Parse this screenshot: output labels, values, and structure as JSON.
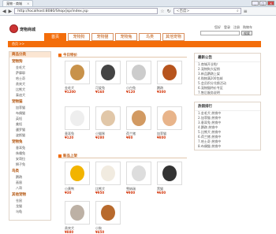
{
  "browser": {
    "tab_title": "宠物 - 商城",
    "tab_close": "×",
    "url": "http://localhost:8080/Shop/jsp/index.jsp",
    "search_placeholder": "<百度>",
    "search_mag": "⌕",
    "nav_back": "◀",
    "nav_forward": "▶",
    "nav_reload": "↻",
    "menu": "≡",
    "star": "☆",
    "win_min": "_",
    "win_max": "□",
    "win_close": "×"
  },
  "site": {
    "logo_text": "宠物商城",
    "top_links": [
      "您好",
      "登录",
      "注册",
      "购物车"
    ],
    "search_btn": "搜索",
    "nav": [
      "首页",
      "宠物狗",
      "宠物猫",
      "宠物兔",
      "鸟类",
      "其他宠物"
    ],
    "orange_bar": "首页 >>"
  },
  "sidebar": {
    "title": "商品分类",
    "groups": [
      {
        "name": "宠物狗",
        "items": [
          "金毛犬",
          "萨摩耶",
          "哈士奇",
          "贵宾犬",
          "比熊犬",
          "泰迪犬"
        ]
      },
      {
        "name": "宠物猫",
        "items": [
          "加菲猫",
          "布偶猫",
          "英短",
          "美短",
          "暹罗猫",
          "波斯猫"
        ]
      },
      {
        "name": "宠物兔",
        "items": [
          "垂耳兔",
          "侏儒兔",
          "安哥拉",
          "狮子兔"
        ]
      },
      {
        "name": "鸟类",
        "items": [
          "鹦鹉",
          "画眉",
          "八哥"
        ]
      },
      {
        "name": "其他宠物",
        "items": [
          "仓鼠",
          "龙猫",
          "乌龟"
        ]
      }
    ]
  },
  "hot": {
    "title": "今日特价",
    "products": [
      {
        "name": "金毛犬",
        "price": "¥1200",
        "color": "#c8924a"
      },
      {
        "name": "可爱兔",
        "price": "¥160",
        "color": "#444"
      },
      {
        "name": "小白兔",
        "price": "¥120",
        "color": "#ccc"
      },
      {
        "name": "鹦鹉",
        "price": "¥300",
        "color": "#b7541d"
      },
      {
        "name": "垂耳兔",
        "price": "¥120",
        "color": "#eee"
      },
      {
        "name": "小猫咪",
        "price": "¥280",
        "color": "#e1c7a8"
      },
      {
        "name": "荷兰猪",
        "price": "¥80",
        "color": "#d29a62"
      },
      {
        "name": "加菲猫",
        "price": "¥800",
        "color": "#e8b48a"
      }
    ]
  },
  "new_items": {
    "title": "新品上架",
    "products": [
      {
        "name": "小黄鸭",
        "price": "¥30",
        "color": "#f2b400"
      },
      {
        "name": "比熊犬",
        "price": "¥950",
        "color": "#f1ebe0"
      },
      {
        "name": "雪纳瑞",
        "price": "¥900",
        "color": "#ddd"
      },
      {
        "name": "黑猫",
        "price": "¥600",
        "color": "#333"
      },
      {
        "name": "贵宾犬",
        "price": "¥880",
        "color": "#bdb1a5"
      },
      {
        "name": "小狗",
        "price": "¥450",
        "color": "#b86a2d"
      }
    ]
  },
  "right": {
    "box1_title": "最新公告",
    "box1": [
      "1.商城开业啦！",
      "2.宠物狗大促销",
      "3.新品鹦鹉上架",
      "4.购物满200包邮",
      "5.会员积分兑换活动",
      "6.宠物猫特价专区",
      "7.售后服务说明"
    ],
    "box2_title": "热销排行",
    "box2": [
      "1.金毛犬 热销中",
      "2.加菲猫 热销中",
      "3.垂耳兔 热销中",
      "4.鹦鹉 热销中",
      "5.比熊犬 热销中",
      "6.荷兰猪 热销中",
      "7.哈士奇 热销中",
      "8.布偶猫 热销中"
    ]
  }
}
